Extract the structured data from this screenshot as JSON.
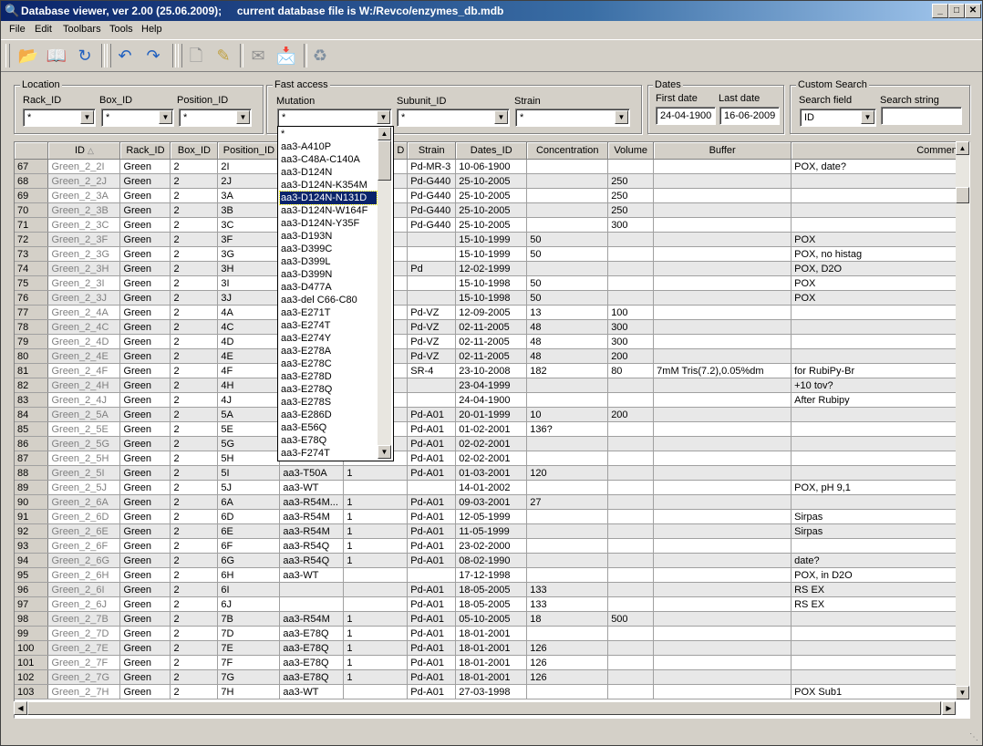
{
  "window": {
    "title": "Database viewer, ver 2.00 (25.06.2009);     current database file is W:/Revco/enzymes_db.mdb"
  },
  "menu": [
    "File",
    "Edit",
    "Toolbars",
    "Tools",
    "Help"
  ],
  "toolbar": [
    "open-folder",
    "open-book",
    "refresh",
    "undo",
    "redo",
    "new-record",
    "edit-pencil",
    "mail",
    "mail-download",
    "recycle"
  ],
  "location": {
    "title": "Location",
    "rack_label": "Rack_ID",
    "rack_value": "*",
    "box_label": "Box_ID",
    "box_value": "*",
    "position_label": "Position_ID",
    "position_value": "*"
  },
  "fast_access": {
    "title": "Fast access",
    "mutation_label": "Mutation",
    "mutation_value": "*",
    "subunit_label": "Subunit_ID",
    "subunit_value": "*",
    "strain_label": "Strain",
    "strain_value": "*"
  },
  "dates": {
    "title": "Dates",
    "first_label": "First date",
    "first_value": "24-04-1900",
    "last_label": "Last date",
    "last_value": "16-06-2009"
  },
  "custom_search": {
    "title": "Custom Search",
    "field_label": "Search field",
    "field_value": "ID",
    "string_label": "Search string",
    "string_value": ""
  },
  "dropdown": {
    "items": [
      "*",
      "aa3-A410P",
      "aa3-C48A-C140A",
      "aa3-D124N",
      "aa3-D124N-K354M",
      "aa3-D124N-N131D",
      "aa3-D124N-W164F",
      "aa3-D124N-Y35F",
      "aa3-D193N",
      "aa3-D399C",
      "aa3-D399L",
      "aa3-D399N",
      "aa3-D477A",
      "aa3-del C66-C80",
      "aa3-E271T",
      "aa3-E274T",
      "aa3-E274Y",
      "aa3-E278A",
      "aa3-E278C",
      "aa3-E278D",
      "aa3-E278Q",
      "aa3-E278S",
      "aa3-E286D",
      "aa3-E56Q",
      "aa3-E78Q",
      "aa3-F274T"
    ],
    "selected_index": 5
  },
  "table": {
    "columns": [
      "ID",
      "Rack_ID",
      "Box_ID",
      "Position_ID",
      "Mutation",
      "Subunit_ID",
      "Strain",
      "Dates_ID",
      "Concentration",
      "Volume",
      "Buffer",
      "Comment_"
    ],
    "column_headers_visible": [
      "ID",
      "Rack_ID",
      "Box_ID",
      "Position_ID",
      "",
      "D",
      "Strain",
      "Dates_ID",
      "Concentration",
      "Volume",
      "Buffer",
      "Comment_"
    ],
    "rows": [
      [
        "67",
        "Green_2_2I",
        "Green",
        "2",
        "2I",
        "",
        "",
        "Pd-MR-3",
        "10-06-1900",
        "",
        "",
        "",
        "POX, date?"
      ],
      [
        "68",
        "Green_2_2J",
        "Green",
        "2",
        "2J",
        "",
        "",
        "Pd-G440",
        "25-10-2005",
        "",
        "250",
        "",
        ""
      ],
      [
        "69",
        "Green_2_3A",
        "Green",
        "2",
        "3A",
        "",
        "",
        "Pd-G440",
        "25-10-2005",
        "",
        "250",
        "",
        ""
      ],
      [
        "70",
        "Green_2_3B",
        "Green",
        "2",
        "3B",
        "",
        "",
        "Pd-G440",
        "25-10-2005",
        "",
        "250",
        "",
        ""
      ],
      [
        "71",
        "Green_2_3C",
        "Green",
        "2",
        "3C",
        "",
        "",
        "Pd-G440",
        "25-10-2005",
        "",
        "300",
        "",
        ""
      ],
      [
        "72",
        "Green_2_3F",
        "Green",
        "2",
        "3F",
        "",
        "",
        "",
        "15-10-1999",
        "50",
        "",
        "",
        "POX"
      ],
      [
        "73",
        "Green_2_3G",
        "Green",
        "2",
        "3G",
        "",
        "",
        "",
        "15-10-1999",
        "50",
        "",
        "",
        "POX, no histag"
      ],
      [
        "74",
        "Green_2_3H",
        "Green",
        "2",
        "3H",
        "",
        "",
        "Pd",
        "12-02-1999",
        "",
        "",
        "",
        "POX, D2O"
      ],
      [
        "75",
        "Green_2_3I",
        "Green",
        "2",
        "3I",
        "",
        "",
        "",
        "15-10-1998",
        "50",
        "",
        "",
        "POX"
      ],
      [
        "76",
        "Green_2_3J",
        "Green",
        "2",
        "3J",
        "",
        "",
        "",
        "15-10-1998",
        "50",
        "",
        "",
        "POX"
      ],
      [
        "77",
        "Green_2_4A",
        "Green",
        "2",
        "4A",
        "",
        "",
        "Pd-VZ",
        "12-09-2005",
        "13",
        "100",
        "",
        ""
      ],
      [
        "78",
        "Green_2_4C",
        "Green",
        "2",
        "4C",
        "",
        "",
        "Pd-VZ",
        "02-11-2005",
        "48",
        "300",
        "",
        ""
      ],
      [
        "79",
        "Green_2_4D",
        "Green",
        "2",
        "4D",
        "",
        "",
        "Pd-VZ",
        "02-11-2005",
        "48",
        "300",
        "",
        ""
      ],
      [
        "80",
        "Green_2_4E",
        "Green",
        "2",
        "4E",
        "",
        "",
        "Pd-VZ",
        "02-11-2005",
        "48",
        "200",
        "",
        ""
      ],
      [
        "81",
        "Green_2_4F",
        "Green",
        "2",
        "4F",
        "",
        "",
        "SR-4",
        "23-10-2008",
        "182",
        "80",
        "7mM Tris(7.2),0.05%dm",
        "for RubiPy-Br"
      ],
      [
        "82",
        "Green_2_4H",
        "Green",
        "2",
        "4H",
        "",
        "",
        "",
        "23-04-1999",
        "",
        "",
        "",
        "+10 tov?"
      ],
      [
        "83",
        "Green_2_4J",
        "Green",
        "2",
        "4J",
        "",
        "",
        "",
        "24-04-1900",
        "",
        "",
        "",
        "After Rubipy"
      ],
      [
        "84",
        "Green_2_5A",
        "Green",
        "2",
        "5A",
        "",
        "",
        "Pd-A01",
        "20-01-1999",
        "10",
        "200",
        "",
        ""
      ],
      [
        "85",
        "Green_2_5E",
        "Green",
        "2",
        "5E",
        "",
        "",
        "Pd-A01",
        "01-02-2001",
        "136?",
        "",
        "",
        ""
      ],
      [
        "86",
        "Green_2_5G",
        "Green",
        "2",
        "5G",
        "",
        "",
        "Pd-A01",
        "02-02-2001",
        "",
        "",
        "",
        ""
      ],
      [
        "87",
        "Green_2_5H",
        "Green",
        "2",
        "5H",
        "",
        "",
        "Pd-A01",
        "02-02-2001",
        "",
        "",
        "",
        ""
      ],
      [
        "88",
        "Green_2_5I",
        "Green",
        "2",
        "5I",
        "aa3-T50A",
        "1",
        "Pd-A01",
        "01-03-2001",
        "120",
        "",
        "",
        ""
      ],
      [
        "89",
        "Green_2_5J",
        "Green",
        "2",
        "5J",
        "aa3-WT",
        "",
        "",
        "14-01-2002",
        "",
        "",
        "",
        "POX, pH 9,1"
      ],
      [
        "90",
        "Green_2_6A",
        "Green",
        "2",
        "6A",
        "aa3-R54M...",
        "1",
        "Pd-A01",
        "09-03-2001",
        "27",
        "",
        "",
        ""
      ],
      [
        "91",
        "Green_2_6D",
        "Green",
        "2",
        "6D",
        "aa3-R54M",
        "1",
        "Pd-A01",
        "12-05-1999",
        "",
        "",
        "",
        "Sirpas"
      ],
      [
        "92",
        "Green_2_6E",
        "Green",
        "2",
        "6E",
        "aa3-R54M",
        "1",
        "Pd-A01",
        "11-05-1999",
        "",
        "",
        "",
        "Sirpas"
      ],
      [
        "93",
        "Green_2_6F",
        "Green",
        "2",
        "6F",
        "aa3-R54Q",
        "1",
        "Pd-A01",
        "23-02-2000",
        "",
        "",
        "",
        ""
      ],
      [
        "94",
        "Green_2_6G",
        "Green",
        "2",
        "6G",
        "aa3-R54Q",
        "1",
        "Pd-A01",
        "08-02-1990",
        "",
        "",
        "",
        "date?"
      ],
      [
        "95",
        "Green_2_6H",
        "Green",
        "2",
        "6H",
        "aa3-WT",
        "",
        "",
        "17-12-1998",
        "",
        "",
        "",
        "POX, in D2O"
      ],
      [
        "96",
        "Green_2_6I",
        "Green",
        "2",
        "6I",
        "",
        "",
        "Pd-A01",
        "18-05-2005",
        "133",
        "",
        "",
        "RS EX"
      ],
      [
        "97",
        "Green_2_6J",
        "Green",
        "2",
        "6J",
        "",
        "",
        "Pd-A01",
        "18-05-2005",
        "133",
        "",
        "",
        "RS EX"
      ],
      [
        "98",
        "Green_2_7B",
        "Green",
        "2",
        "7B",
        "aa3-R54M",
        "1",
        "Pd-A01",
        "05-10-2005",
        "18",
        "500",
        "",
        ""
      ],
      [
        "99",
        "Green_2_7D",
        "Green",
        "2",
        "7D",
        "aa3-E78Q",
        "1",
        "Pd-A01",
        "18-01-2001",
        "",
        "",
        "",
        ""
      ],
      [
        "100",
        "Green_2_7E",
        "Green",
        "2",
        "7E",
        "aa3-E78Q",
        "1",
        "Pd-A01",
        "18-01-2001",
        "126",
        "",
        "",
        ""
      ],
      [
        "101",
        "Green_2_7F",
        "Green",
        "2",
        "7F",
        "aa3-E78Q",
        "1",
        "Pd-A01",
        "18-01-2001",
        "126",
        "",
        "",
        ""
      ],
      [
        "102",
        "Green_2_7G",
        "Green",
        "2",
        "7G",
        "aa3-E78Q",
        "1",
        "Pd-A01",
        "18-01-2001",
        "126",
        "",
        "",
        ""
      ],
      [
        "103",
        "Green_2_7H",
        "Green",
        "2",
        "7H",
        "aa3-WT",
        "",
        "Pd-A01",
        "27-03-1998",
        "",
        "",
        "",
        "POX Sub1"
      ]
    ]
  }
}
